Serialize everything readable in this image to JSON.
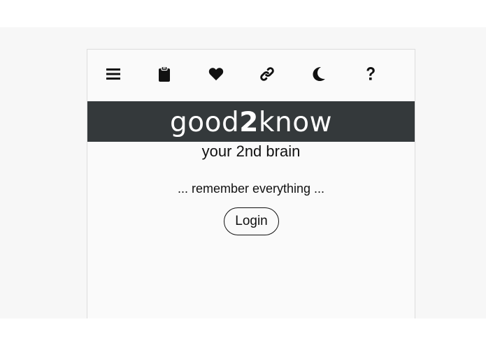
{
  "toolbar": {
    "icons": [
      "menu-icon",
      "clipboard-icon",
      "heart-icon",
      "link-icon",
      "moon-icon",
      "question-icon"
    ]
  },
  "banner": {
    "brand_part1": "good",
    "brand_part2": "2",
    "brand_part3": "know"
  },
  "tagline": "your 2nd brain",
  "motto": "... remember everything ...",
  "login": {
    "label": "Login"
  },
  "colors": {
    "banner_bg": "#34393b",
    "text": "#111111",
    "card_bg": "#fafafa"
  }
}
